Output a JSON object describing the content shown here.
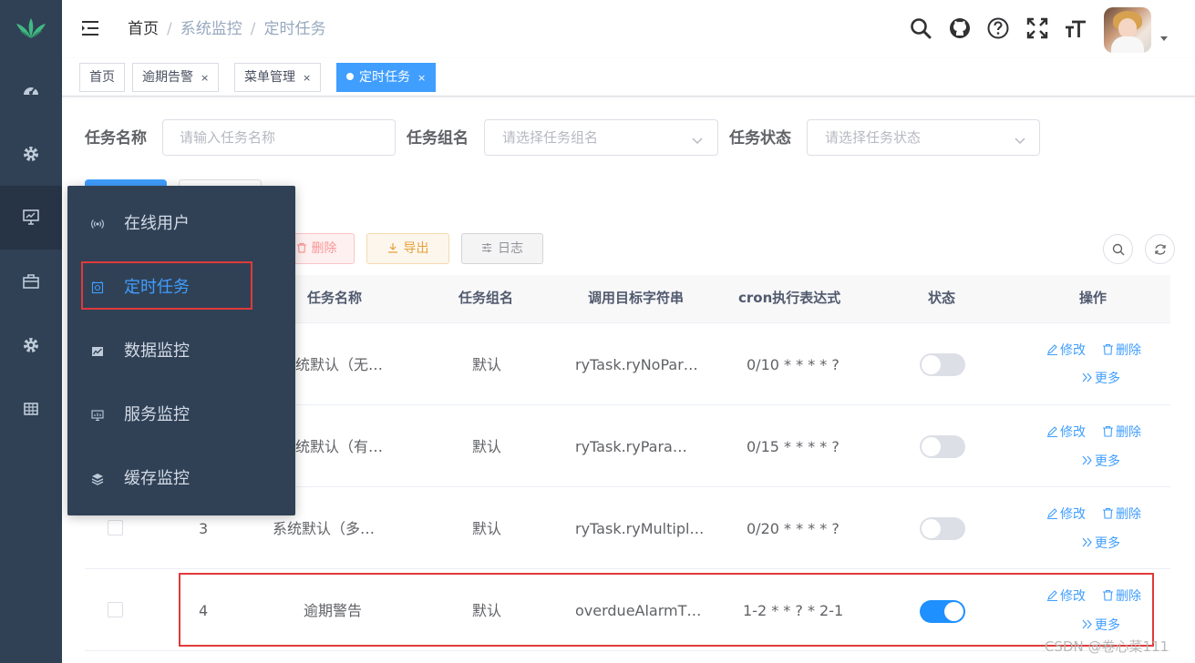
{
  "breadcrumb": [
    "首页",
    "系统监控",
    "定时任务"
  ],
  "tags": [
    {
      "label": "首页",
      "closable": false,
      "active": false
    },
    {
      "label": "逾期告警",
      "closable": true,
      "active": false
    },
    {
      "label": "菜单管理",
      "closable": true,
      "active": false
    },
    {
      "label": "定时任务",
      "closable": true,
      "active": true
    }
  ],
  "tag_close": "×",
  "search": {
    "job_name_label": "任务名称",
    "job_name_placeholder": "请输入任务名称",
    "job_group_label": "任务组名",
    "job_group_placeholder": "请选择任务组名",
    "status_label": "任务状态",
    "status_placeholder": "请选择任务状态"
  },
  "toolbar": {
    "delete_label": "删除",
    "export_label": "导出",
    "log_label": "日志"
  },
  "flyout_menu": [
    {
      "label": "在线用户",
      "icon": "online-icon",
      "active": false
    },
    {
      "label": "定时任务",
      "icon": "job-icon",
      "active": true
    },
    {
      "label": "数据监控",
      "icon": "druid-icon",
      "active": false
    },
    {
      "label": "服务监控",
      "icon": "server-icon",
      "active": false
    },
    {
      "label": "缓存监控",
      "icon": "redis-icon",
      "active": false
    }
  ],
  "table": {
    "columns": [
      "任务名称",
      "任务组名",
      "调用目标字符串",
      "cron执行表达式",
      "状态",
      "操作"
    ],
    "rows": [
      {
        "id": "",
        "name": "统默认（无…",
        "group": "默认",
        "target": "ryTask.ryNoPar…",
        "cron": "0/10 * * * * ?",
        "status_on": false
      },
      {
        "id": "",
        "name": "统默认（有…",
        "group": "默认",
        "target": "ryTask.ryPara…",
        "cron": "0/15 * * * * ?",
        "status_on": false
      },
      {
        "id": "3",
        "name": "系统默认（多…",
        "group": "默认",
        "target": "ryTask.ryMultipl…",
        "cron": "0/20 * * * * ?",
        "status_on": false
      },
      {
        "id": "4",
        "name": "逾期警告",
        "group": "默认",
        "target": "overdueAlarmT…",
        "cron": "1-2 * * ? * 2-1",
        "status_on": true
      }
    ],
    "actions": {
      "edit": "修改",
      "delete": "删除",
      "more": "更多"
    }
  },
  "watermark": "CSDN @卷心菜111",
  "colors": {
    "sidebar": "#304156",
    "primary": "#409eff",
    "highlight": "#e03a3a"
  }
}
